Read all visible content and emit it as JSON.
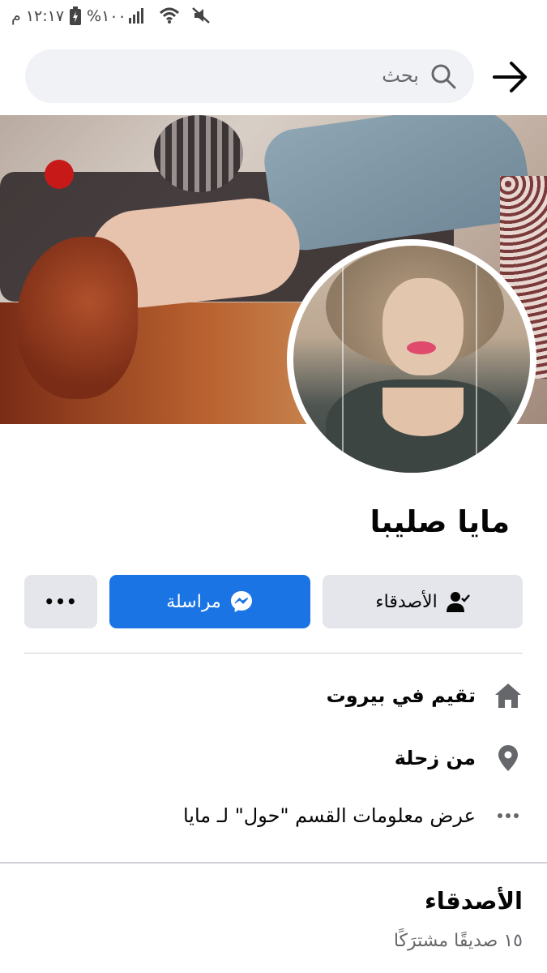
{
  "status_bar": {
    "time": "١٢:١٧ م",
    "battery": "%١٠٠"
  },
  "header": {
    "search_placeholder": "بحث"
  },
  "profile": {
    "name": "مايا صليبا"
  },
  "actions": {
    "friends_label": "الأصدقاء",
    "message_label": "مراسلة",
    "more_label": "•••"
  },
  "intro": {
    "lives_in": "تقيم في بيروت",
    "from": "من زحلة",
    "see_about": "عرض معلومات القسم \"حول\" لـ مايا"
  },
  "friends": {
    "title": "الأصدقاء",
    "mutual": "١٥ صديقًا مشترَكًا"
  },
  "colors": {
    "accent": "#1b74e4",
    "button_gray": "#e4e6eb",
    "secondary_text": "#65676b",
    "icon_gray": "#65676b"
  },
  "icons": [
    "search-icon",
    "back-arrow-icon",
    "home-icon",
    "location-pin-icon",
    "more-dots-icon",
    "friends-check-icon",
    "messenger-icon",
    "mute-icon",
    "wifi-icon",
    "signal-icon",
    "battery-charging-icon"
  ]
}
